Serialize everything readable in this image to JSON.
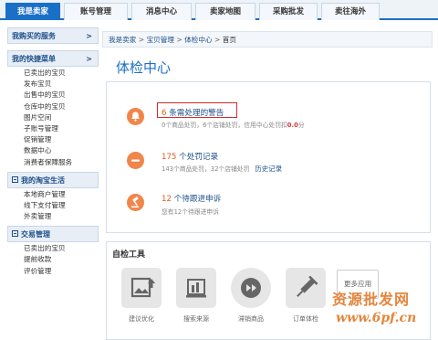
{
  "topnav": {
    "tabs": [
      {
        "label": "我是卖家",
        "active": true
      },
      {
        "label": "账号管理",
        "active": false
      },
      {
        "label": "消息中心",
        "active": false
      },
      {
        "label": "卖家地图",
        "active": false
      },
      {
        "label": "采购批发",
        "active": false
      },
      {
        "label": "卖往海外",
        "active": false
      }
    ]
  },
  "sidebar": {
    "sec1": {
      "title": "我购买的服务",
      "arrow": ">"
    },
    "sec2": {
      "title": "我的快捷菜单",
      "arrow": ">",
      "items": [
        "已卖出的宝贝",
        "发布宝贝",
        "出售中的宝贝",
        "仓库中的宝贝",
        "图片空间",
        "子账号管理",
        "促销管理",
        "数据中心",
        "消费者保障服务"
      ]
    },
    "sec3": {
      "title": "我的淘宝生活",
      "items": [
        "本地商户管理",
        "线下支付管理",
        "外卖管理"
      ]
    },
    "sec4": {
      "title": "交易管理",
      "items": [
        "已卖出的宝贝",
        "提前收款",
        "评价管理"
      ]
    }
  },
  "breadcrumb": {
    "items": [
      "我是卖家",
      "宝贝管理",
      "体检中心",
      "首页"
    ],
    "sep": ">"
  },
  "page": {
    "title": "体检中心"
  },
  "checks": {
    "alerts": {
      "count": "6",
      "label": " 条需处理的警告",
      "sub_prefix": "0个商品处罚，6个店铺处罚，信用中心处罚扣",
      "sub_score": "0.0",
      "sub_suffix": "分"
    },
    "penalties": {
      "count": "175",
      "label": " 个处罚记录",
      "sub": "143个商品处罚，32个店铺处罚",
      "link": "历史记录"
    },
    "appeals": {
      "count": "12",
      "label": " 个待跟进申诉",
      "sub": "您有12个待跟进申诉"
    }
  },
  "tools": {
    "title": "自检工具",
    "items": [
      {
        "label": "建议优化",
        "icon": "image-upload-icon"
      },
      {
        "label": "搜索来源",
        "icon": "search-source-icon"
      },
      {
        "label": "滞销商品",
        "icon": "refresh-icon"
      },
      {
        "label": "订单体检",
        "icon": "syringe-icon"
      }
    ],
    "more": "更多应用"
  },
  "watermark": {
    "cn": "资源批发网",
    "url": "www.6pf.cn"
  },
  "colors": {
    "accent": "#1a6fc7",
    "orange": "#f0864a",
    "highlight": "#d32a2a"
  }
}
